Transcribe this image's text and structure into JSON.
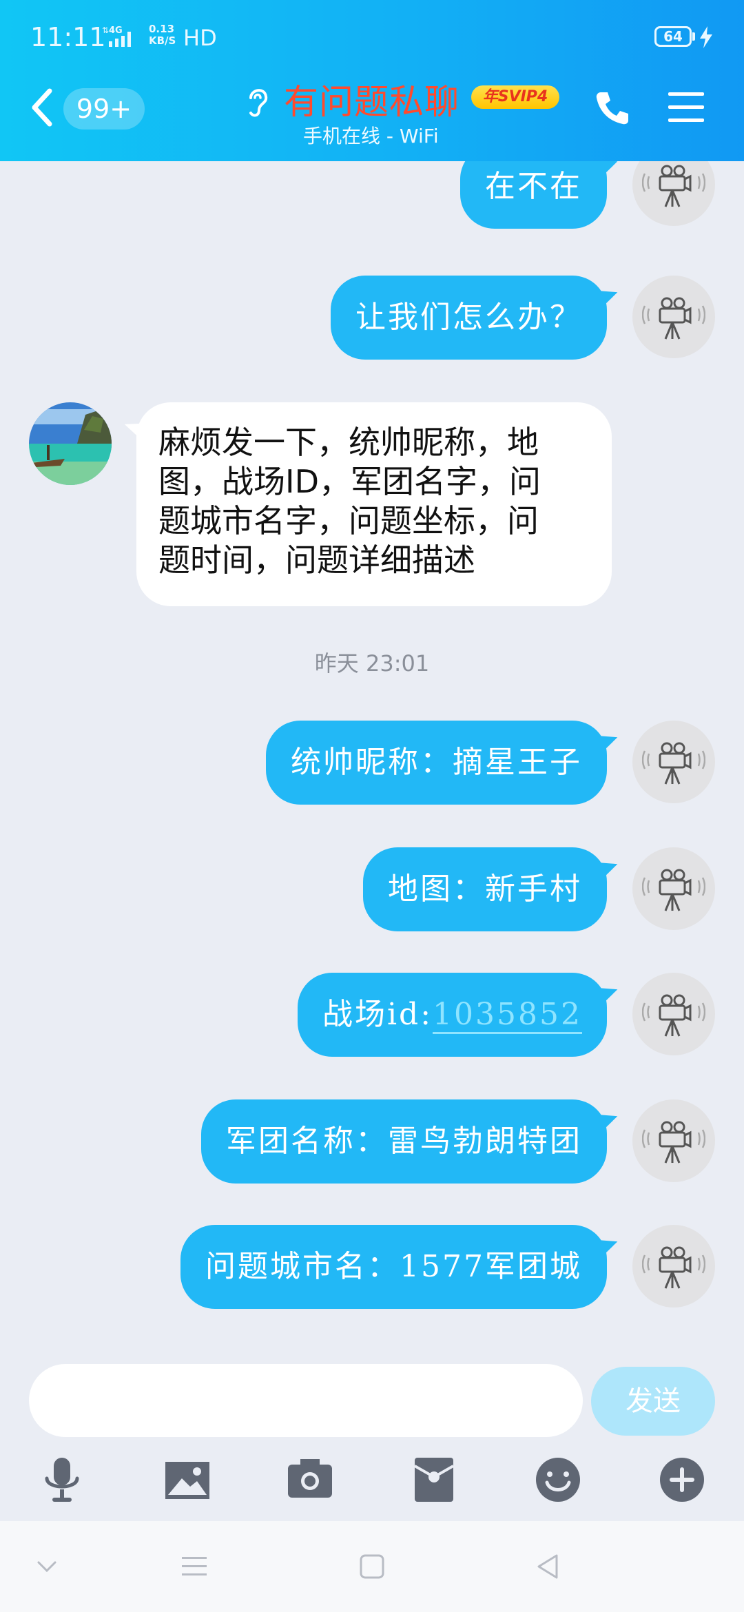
{
  "status_bar": {
    "time": "11:11",
    "network": "4G",
    "speed_value": "0.13",
    "speed_unit": "KB/S",
    "hd": "HD",
    "battery": "64"
  },
  "header": {
    "unread_badge": "99+",
    "title": "有问题私聊",
    "vip_badge": "年SVIP4",
    "subtitle": "手机在线 - WiFi"
  },
  "messages": [
    {
      "side": "out",
      "text": "在不在"
    },
    {
      "side": "out",
      "text": "让我们怎么办？"
    },
    {
      "side": "in",
      "lines": [
        "麻烦发一下，统帅昵称，地",
        "图，战场ID，军团名字，问",
        "题城市名字，问题坐标，问",
        "题时间，问题详细描述"
      ]
    },
    {
      "side": "time",
      "text": "昨天 23:01"
    },
    {
      "side": "out",
      "text": "统帅昵称：摘星王子"
    },
    {
      "side": "out",
      "text": "地图：新手村"
    },
    {
      "side": "out",
      "text_prefix": "战场id:",
      "link": "1035852"
    },
    {
      "side": "out",
      "text": "军团名称：雷鸟勃朗特团"
    },
    {
      "side": "out",
      "text": "问题城市名：1577军团城"
    }
  ],
  "input": {
    "placeholder": "",
    "send_label": "发送"
  },
  "toolbar": [
    "microphone-icon",
    "image-icon",
    "camera-icon",
    "red-packet-icon",
    "emoji-icon",
    "plus-icon"
  ],
  "colors": {
    "header_start": "#11c6f5",
    "header_end": "#1199f3",
    "bubble_out": "#22b8f6",
    "title": "#ff4a2e",
    "background": "#eaedf4"
  }
}
